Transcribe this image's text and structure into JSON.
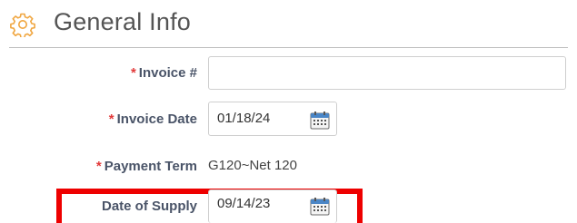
{
  "section": {
    "title": "General Info",
    "icon": "gear-icon"
  },
  "required_marker": "*",
  "fields": {
    "invoice_number": {
      "label": "Invoice #",
      "value": ""
    },
    "invoice_date": {
      "label": "Invoice Date",
      "value": "01/18/24"
    },
    "payment_term": {
      "label": "Payment Term",
      "value": "G120~Net 120"
    },
    "date_of_supply": {
      "label": "Date of Supply",
      "value": "09/14/23"
    }
  },
  "colors": {
    "required": "#e23a3a",
    "label": "#4a5468",
    "highlight": "#ee0000",
    "icon": "#f0a640",
    "calendar": "#4a86c7"
  }
}
